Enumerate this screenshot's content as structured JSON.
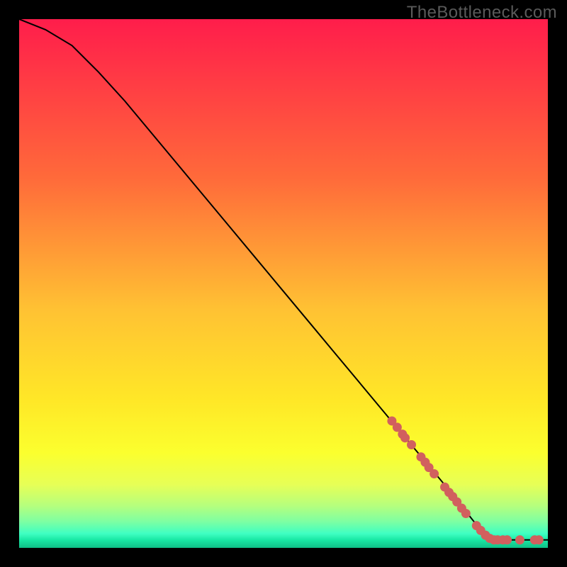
{
  "watermark": "TheBottleneck.com",
  "chart_data": {
    "type": "line",
    "title": "",
    "xlabel": "",
    "ylabel": "",
    "xlim": [
      0,
      100
    ],
    "ylim": [
      0,
      100
    ],
    "series": [
      {
        "name": "curve",
        "x": [
          0,
          5,
          10,
          15,
          20,
          25,
          30,
          35,
          40,
          45,
          50,
          55,
          60,
          65,
          70,
          75,
          80,
          82,
          84,
          86,
          88,
          90,
          92,
          94,
          96,
          98,
          100
        ],
        "y": [
          100,
          98,
          95,
          90,
          84.5,
          78.5,
          72.5,
          66.5,
          60.5,
          54.5,
          48.5,
          42.5,
          36.5,
          30.5,
          24.5,
          18.5,
          12.5,
          10,
          7.5,
          5,
          2.5,
          1.5,
          1.5,
          1.5,
          1.5,
          1.5,
          1.5
        ]
      }
    ],
    "highlight_dots": [
      {
        "x": 70.5,
        "y": 24
      },
      {
        "x": 71.5,
        "y": 22.8
      },
      {
        "x": 72.5,
        "y": 21.5
      },
      {
        "x": 73.0,
        "y": 20.8
      },
      {
        "x": 74.2,
        "y": 19.5
      },
      {
        "x": 76.0,
        "y": 17.2
      },
      {
        "x": 76.8,
        "y": 16.2
      },
      {
        "x": 77.5,
        "y": 15.2
      },
      {
        "x": 78.5,
        "y": 14
      },
      {
        "x": 80.5,
        "y": 11.5
      },
      {
        "x": 81.3,
        "y": 10.5
      },
      {
        "x": 82.0,
        "y": 9.7
      },
      {
        "x": 82.8,
        "y": 8.7
      },
      {
        "x": 83.7,
        "y": 7.5
      },
      {
        "x": 84.5,
        "y": 6.5
      },
      {
        "x": 86.5,
        "y": 4.2
      },
      {
        "x": 87.3,
        "y": 3.3
      },
      {
        "x": 88.2,
        "y": 2.4
      },
      {
        "x": 89.0,
        "y": 1.8
      },
      {
        "x": 89.8,
        "y": 1.5
      },
      {
        "x": 90.5,
        "y": 1.5
      },
      {
        "x": 91.5,
        "y": 1.5
      },
      {
        "x": 92.3,
        "y": 1.5
      },
      {
        "x": 94.7,
        "y": 1.5
      },
      {
        "x": 97.5,
        "y": 1.5
      },
      {
        "x": 98.3,
        "y": 1.5
      }
    ],
    "colors": {
      "gradient_stops": [
        {
          "p": 0,
          "c": "#ff1d4b"
        },
        {
          "p": 30,
          "c": "#ff6a3a"
        },
        {
          "p": 55,
          "c": "#ffc233"
        },
        {
          "p": 72,
          "c": "#ffe727"
        },
        {
          "p": 82,
          "c": "#fbff2e"
        },
        {
          "p": 88,
          "c": "#e7ff56"
        },
        {
          "p": 92,
          "c": "#b6ff7d"
        },
        {
          "p": 95,
          "c": "#7effa2"
        },
        {
          "p": 97.3,
          "c": "#3fffc2"
        },
        {
          "p": 98.5,
          "c": "#19e8a4"
        },
        {
          "p": 100,
          "c": "#0fbf86"
        }
      ],
      "curve": "#000000",
      "dot_fill": "#d1605e",
      "dot_stroke": "#d1605e"
    }
  }
}
